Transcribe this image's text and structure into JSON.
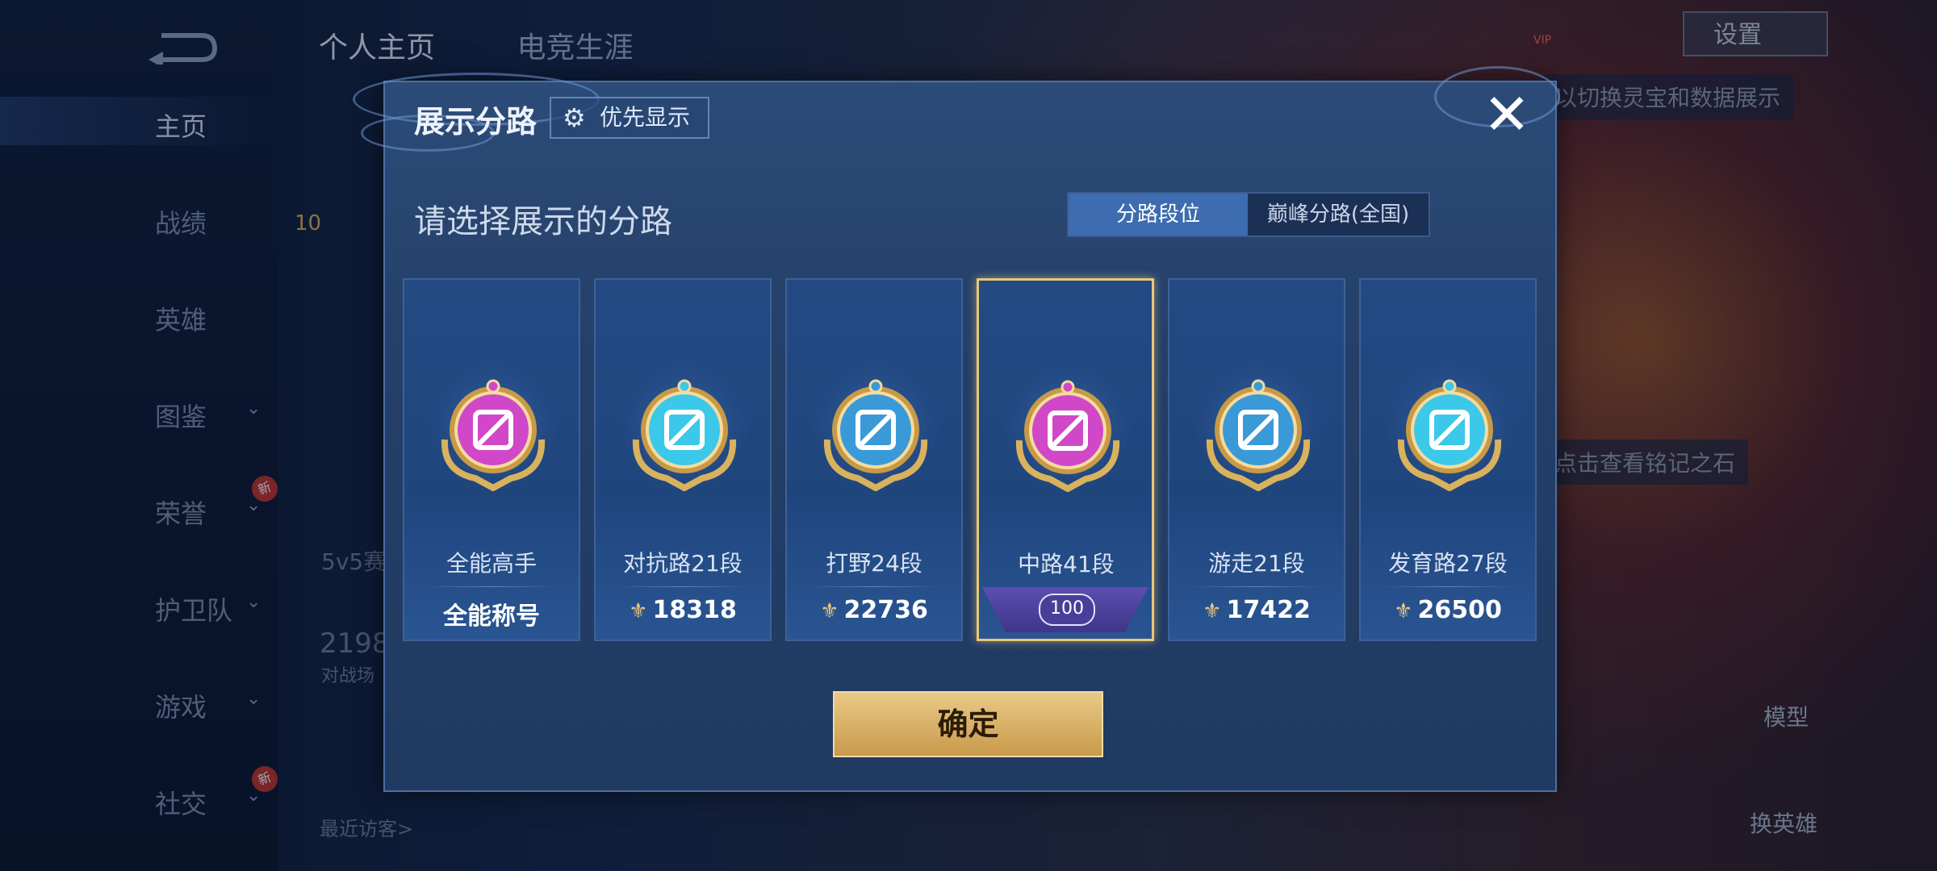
{
  "background": {
    "back_icon": "back-arrow-icon",
    "tabs": [
      "个人主页",
      "电竞生涯"
    ],
    "sidebar": [
      {
        "label": "主页",
        "chevron": false,
        "badge": ""
      },
      {
        "label": "战绩",
        "chevron": false,
        "badge": ""
      },
      {
        "label": "英雄",
        "chevron": false,
        "badge": ""
      },
      {
        "label": "图鉴",
        "chevron": true,
        "badge": ""
      },
      {
        "label": "荣誉",
        "chevron": true,
        "badge": "新"
      },
      {
        "label": "护卫队",
        "chevron": true,
        "badge": ""
      },
      {
        "label": "游戏",
        "chevron": true,
        "badge": ""
      },
      {
        "label": "社交",
        "chevron": true,
        "badge": "新"
      }
    ],
    "level": "10",
    "stat_number": "2198",
    "stat_caption": "对战场",
    "mode_text": "5v5赛",
    "recent_visitors_label": "最近访客>",
    "settings_label": "设置",
    "vip_label": "VIP",
    "hint_switch": "以切换灵宝和数据展示",
    "hint_inscription": "点击查看铭记之石",
    "model_label": "模型",
    "change_hero_label": "换英雄",
    "new_badge": "新"
  },
  "modal": {
    "title": "展示分路",
    "priority_button": "优先显示",
    "priority_icon": "gear-icon",
    "close_icon": "close-icon",
    "subtitle": "请选择展示的分路",
    "segments": [
      "分路段位",
      "巅峰分路(全国)"
    ],
    "active_segment": 0,
    "cards": [
      {
        "name": "全能高手",
        "value": "全能称号",
        "icon": "allround-badge-icon",
        "value_icon": false,
        "selected": false,
        "color": "#d048c8"
      },
      {
        "name": "对抗路21段",
        "value": "18318",
        "icon": "clash-lane-badge-icon",
        "value_icon": true,
        "selected": false,
        "color": "#3cc8e8"
      },
      {
        "name": "打野24段",
        "value": "22736",
        "icon": "jungle-badge-icon",
        "value_icon": true,
        "selected": false,
        "color": "#3a9ad8"
      },
      {
        "name": "中路41段",
        "value": "100",
        "icon": "mid-lane-badge-icon",
        "value_icon": false,
        "selected": true,
        "color": "#d048c8"
      },
      {
        "name": "游走21段",
        "value": "17422",
        "icon": "roam-badge-icon",
        "value_icon": true,
        "selected": false,
        "color": "#3a9ad8"
      },
      {
        "name": "发育路27段",
        "value": "26500",
        "icon": "farm-lane-badge-icon",
        "value_icon": true,
        "selected": false,
        "color": "#3cc8e8"
      }
    ],
    "confirm_button": "确定"
  },
  "colors": {
    "accent_gold": "#e8c77a",
    "modal_bg": "#244269",
    "segment_active": "#3d6cb0"
  }
}
